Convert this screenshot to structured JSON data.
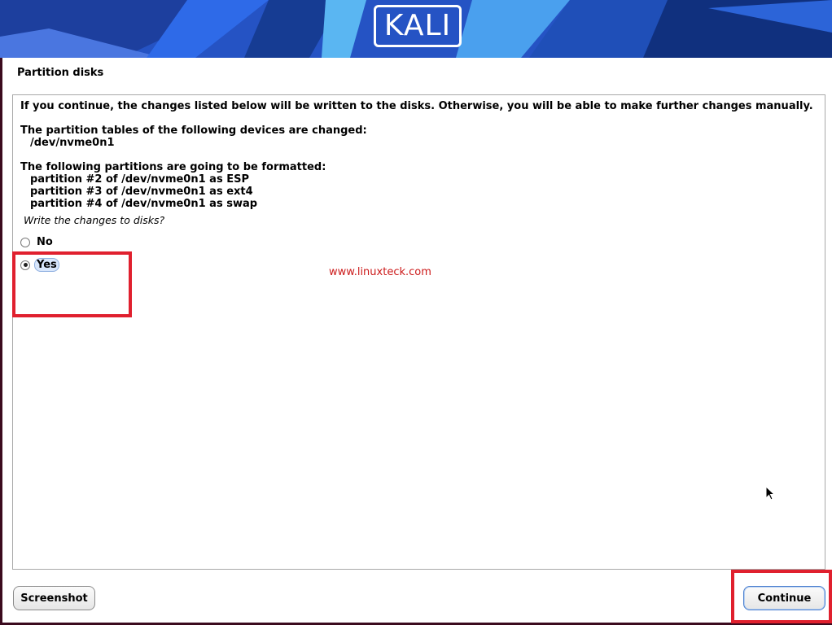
{
  "banner": {
    "logo_text": "KALI"
  },
  "step": {
    "title": "Partition disks"
  },
  "content": {
    "intro": "If you continue, the changes listed below will be written to the disks. Otherwise, you will be able to make further changes manually.",
    "tables_heading": "The partition tables of the following devices are changed:",
    "devices": [
      "/dev/nvme0n1"
    ],
    "format_heading": "The following partitions are going to be formatted:",
    "partitions": [
      "partition #2 of /dev/nvme0n1 as ESP",
      "partition #3 of /dev/nvme0n1 as ext4",
      "partition #4 of /dev/nvme0n1 as swap"
    ],
    "question": "Write the changes to disks?",
    "options": [
      {
        "label": "No",
        "selected": false
      },
      {
        "label": "Yes",
        "selected": true
      }
    ]
  },
  "watermark": "www.linuxteck.com",
  "buttons": {
    "screenshot": "Screenshot",
    "continue": "Continue"
  },
  "colors": {
    "highlight": "#e0202e",
    "watermark": "#cc1a1a",
    "banner": "#2a5fd6"
  }
}
